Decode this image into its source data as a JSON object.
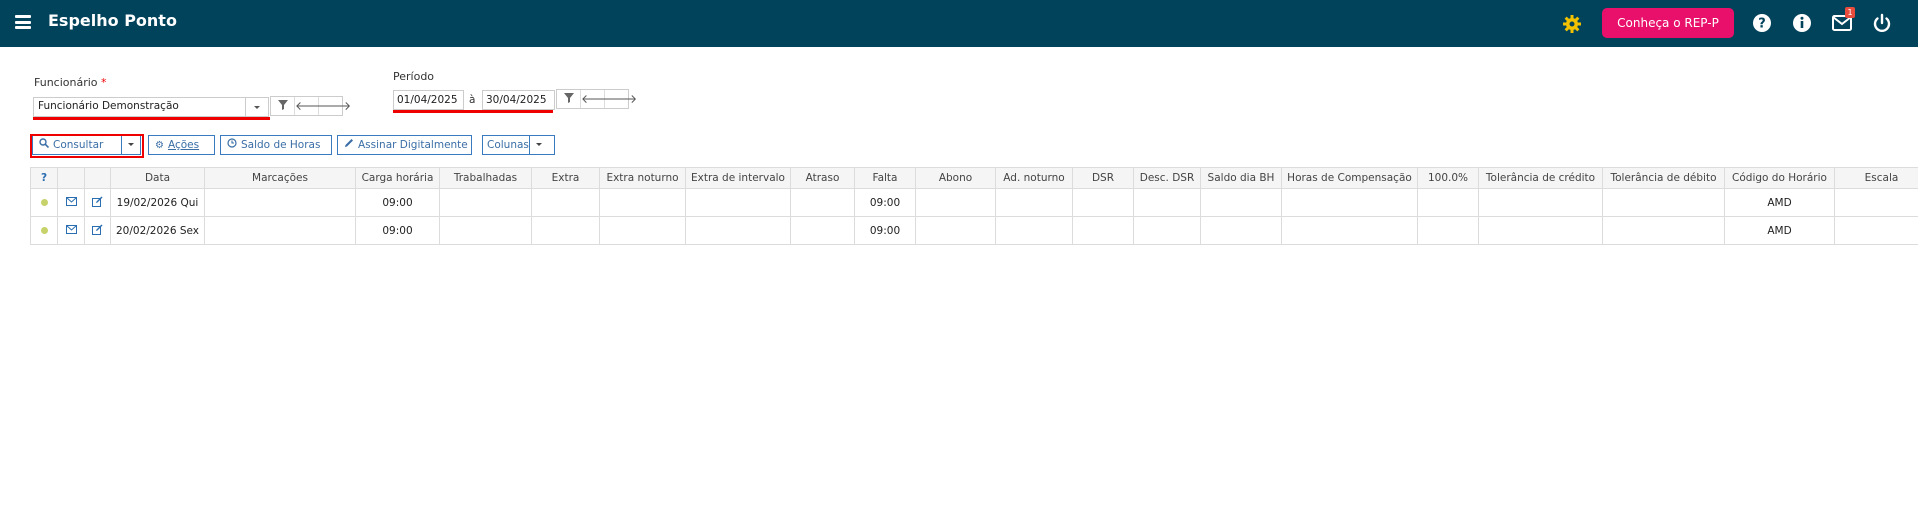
{
  "app": {
    "title": "Espelho Ponto",
    "promo_button": "Conheça o REP-P",
    "mail_count": "1"
  },
  "filters": {
    "employee_label": "Funcionário",
    "employee_required": "*",
    "employee_value": "Funcionário Demonstração",
    "period_label": "Período",
    "period_start": "01/04/2025",
    "period_sep": "à",
    "period_end": "30/04/2025"
  },
  "toolbar": {
    "consultar": "Consultar",
    "acoes": "Ações",
    "saldo": "Saldo de Horas",
    "assinar": "Assinar Digitalmente",
    "colunas": "Colunas"
  },
  "table": {
    "columns": [
      "?",
      "",
      "",
      "Data",
      "Marcações",
      "Carga horária",
      "Trabalhadas",
      "Extra",
      "Extra noturno",
      "Extra de intervalo",
      "Atraso",
      "Falta",
      "Abono",
      "Ad. noturno",
      "DSR",
      "Desc. DSR",
      "Saldo dia BH",
      "Horas de Compensação",
      "100.0%",
      "Tolerância de crédito",
      "Tolerância de débito",
      "Código do Horário",
      "Escala"
    ],
    "rows": [
      {
        "data": "19/02/2026 Qui",
        "marcacoes": "",
        "carga": "09:00",
        "trabalhadas": "",
        "extra": "",
        "extra_noturno": "",
        "extra_intervalo": "",
        "atraso": "",
        "falta": "09:00",
        "abono": "",
        "ad_noturno": "",
        "dsr": "",
        "desc_dsr": "",
        "saldo_bh": "",
        "compensacao": "",
        "cem": "",
        "tol_credito": "",
        "tol_debito": "",
        "codigo": "AMD",
        "escala": ""
      },
      {
        "data": "20/02/2026 Sex",
        "marcacoes": "",
        "carga": "09:00",
        "trabalhadas": "",
        "extra": "",
        "extra_noturno": "",
        "extra_intervalo": "",
        "atraso": "",
        "falta": "09:00",
        "abono": "",
        "ad_noturno": "",
        "dsr": "",
        "desc_dsr": "",
        "saldo_bh": "",
        "compensacao": "",
        "cem": "",
        "tol_credito": "",
        "tol_debito": "",
        "codigo": "AMD",
        "escala": ""
      }
    ]
  },
  "colors": {
    "topbar": "#01435b",
    "promo": "#e8106b",
    "highlight": "#e00000",
    "gear": "#f2c200"
  },
  "icons": [
    "menu-icon",
    "gear-icon",
    "help-icon",
    "info-icon",
    "mail-icon",
    "power-icon",
    "filter-icon",
    "arrow-left-icon",
    "arrow-right-icon",
    "search-icon",
    "clock-icon",
    "pencil-icon",
    "envelope-icon",
    "edit-icon",
    "status-dot-icon"
  ]
}
